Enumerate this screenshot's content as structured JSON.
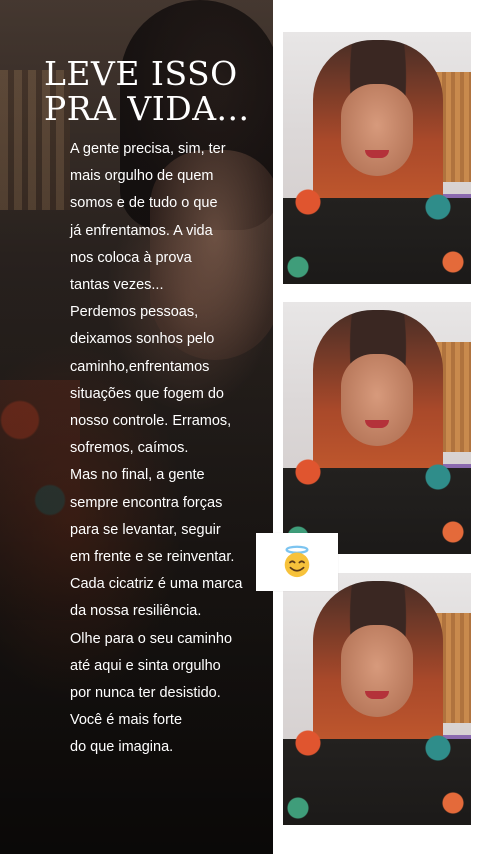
{
  "post": {
    "title_lines": [
      "LEVE ISSO",
      "PRA VIDA..."
    ],
    "body_lines": [
      "A gente precisa, sim, ter",
      "mais orgulho de quem",
      "somos e de tudo o que",
      "já enfrentamos. A vida",
      "nos coloca à prova",
      "tantas vezes...",
      "Perdemos pessoas,",
      "deixamos sonhos pelo",
      "caminho,enfrentamos",
      "situações que fogem do",
      "nosso controle. Erramos,",
      "sofremos, caímos.",
      "Mas no final, a gente",
      "sempre encontra forças",
      "para se levantar, seguir",
      "em frente e se reinventar.",
      "Cada cicatriz é uma marca",
      "da nossa resiliência.",
      "Olhe para o seu caminho",
      "até aqui e sinta orgulho",
      "por nunca ter desistido.",
      "Você é mais forte",
      "do que imagina."
    ],
    "emoji": "smiling-face-with-halo-icon",
    "photos": [
      "portrait",
      "portrait",
      "portrait"
    ],
    "colors": {
      "text": "#ffffff",
      "background": "#ffffff",
      "emoji_face": "#f7c23b",
      "halo": "#7cc4f0"
    }
  }
}
